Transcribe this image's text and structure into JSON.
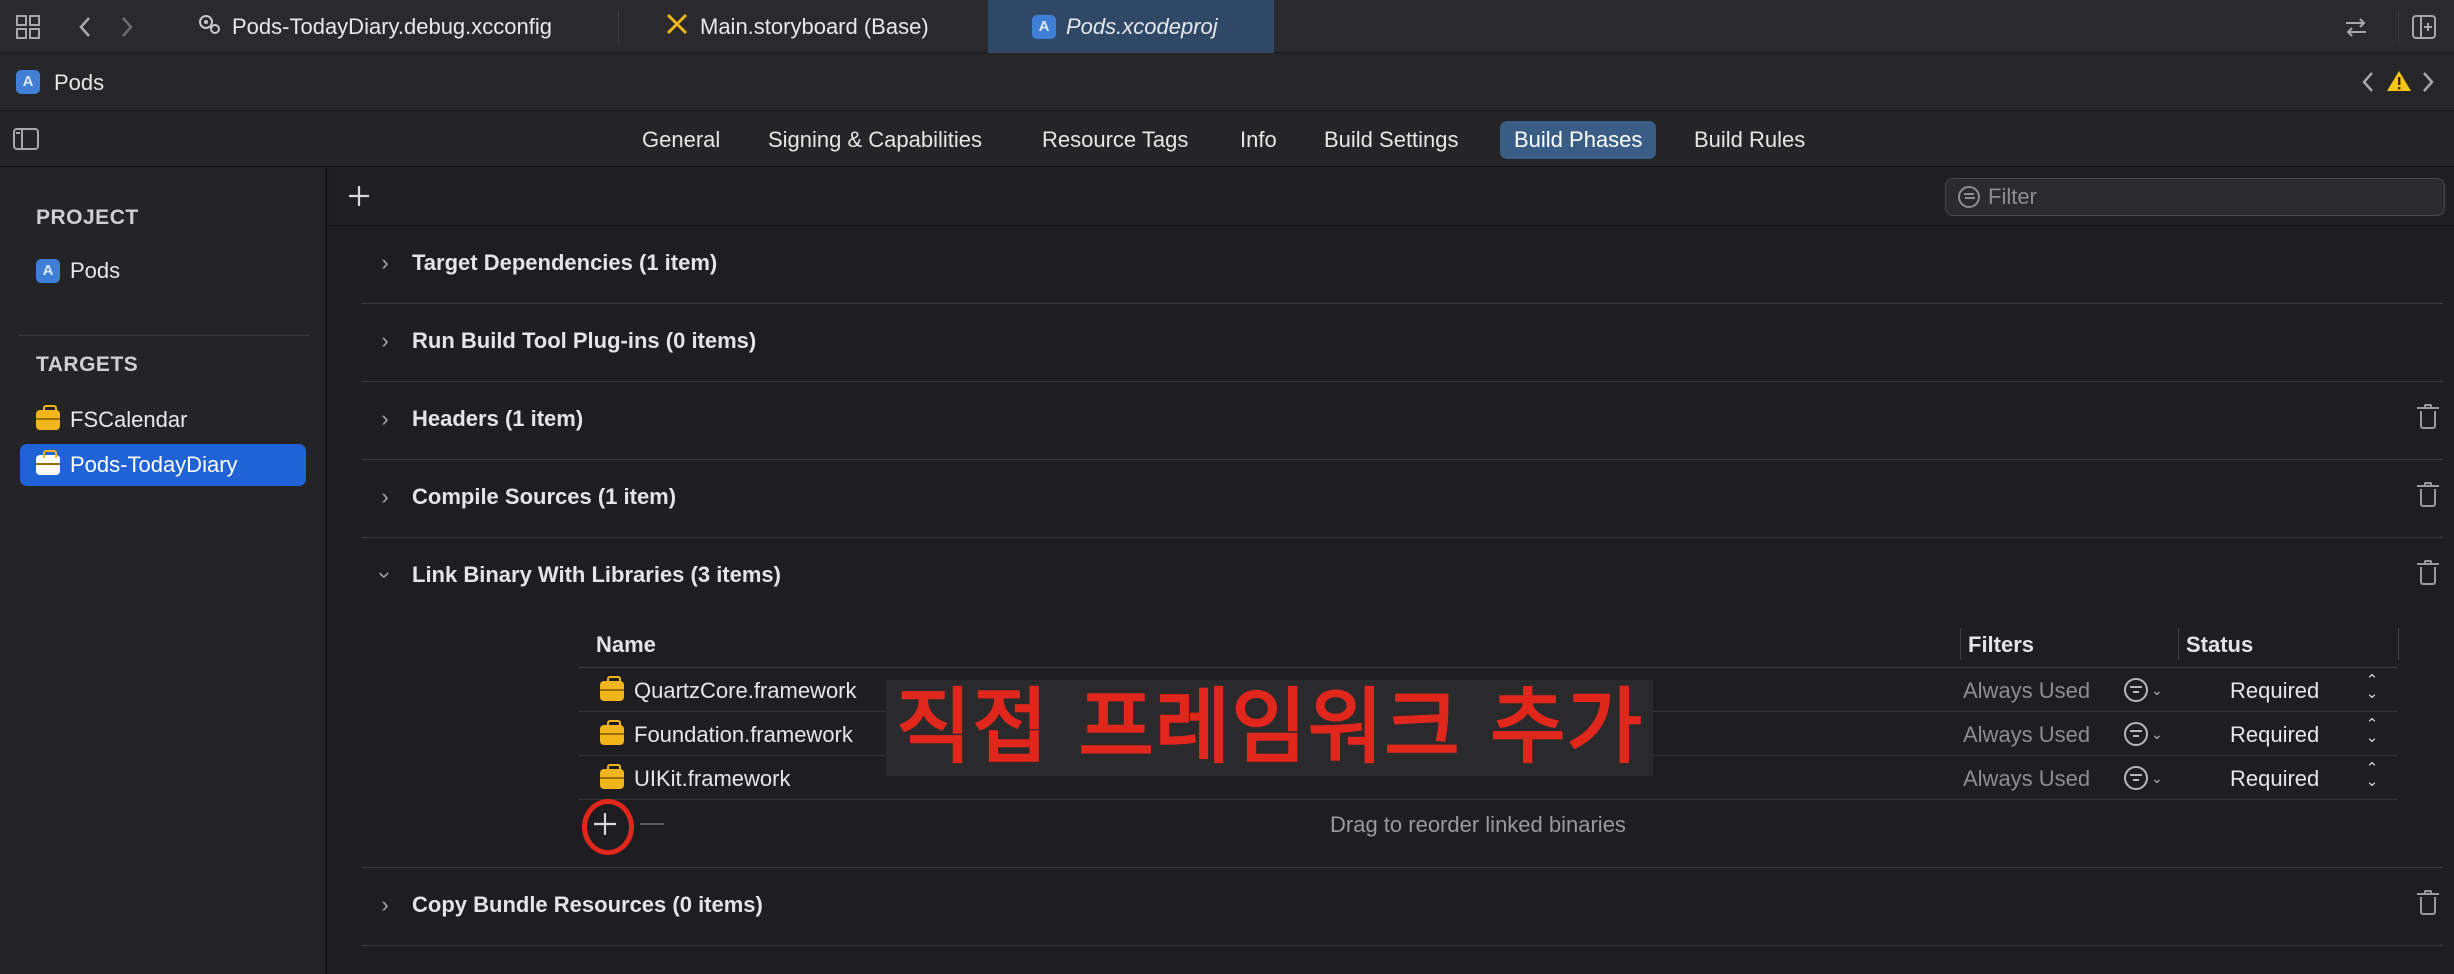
{
  "window": {
    "tabs": [
      {
        "label": "Pods-TodayDiary.debug.xcconfig",
        "icon": "gear-icon",
        "active": false
      },
      {
        "label": "Main.storyboard (Base)",
        "icon": "storyboard-icon",
        "active": false
      },
      {
        "label": "Pods.xcodeproj",
        "icon": "project-icon",
        "active": true
      }
    ]
  },
  "pathbar": {
    "project": "Pods"
  },
  "editor_tabs": [
    "General",
    "Signing & Capabilities",
    "Resource Tags",
    "Info",
    "Build Settings",
    "Build Phases",
    "Build Rules"
  ],
  "editor_tabs_selected": "Build Phases",
  "sidebar": {
    "project_header": "PROJECT",
    "project_item": "Pods",
    "targets_header": "TARGETS",
    "targets": [
      "FSCalendar",
      "Pods-TodayDiary"
    ],
    "selected_target": "Pods-TodayDiary"
  },
  "filter": {
    "placeholder": "Filter"
  },
  "phases": [
    {
      "title": "Target Dependencies (1 item)",
      "expanded": false,
      "deletable": false
    },
    {
      "title": "Run Build Tool Plug-ins (0 items)",
      "expanded": false,
      "deletable": false
    },
    {
      "title": "Headers (1 item)",
      "expanded": false,
      "deletable": true
    },
    {
      "title": "Compile Sources (1 item)",
      "expanded": false,
      "deletable": true
    },
    {
      "title": "Link Binary With Libraries (3 items)",
      "expanded": true,
      "deletable": true
    },
    {
      "title": "Copy Bundle Resources (0 items)",
      "expanded": false,
      "deletable": true
    }
  ],
  "libraries": {
    "columns": {
      "name": "Name",
      "filters": "Filters",
      "status": "Status"
    },
    "rows": [
      {
        "name": "QuartzCore.framework",
        "filters": "Always Used",
        "status": "Required"
      },
      {
        "name": "Foundation.framework",
        "filters": "Always Used",
        "status": "Required"
      },
      {
        "name": "UIKit.framework",
        "filters": "Always Used",
        "status": "Required"
      }
    ],
    "footer_hint": "Drag to reorder linked binaries"
  },
  "annotation": {
    "text": "직접 프레임워크 추가",
    "color": "#e1261c"
  },
  "colors": {
    "accent": "#1f63d6",
    "selected_tab": "#3a5d86",
    "warning": "#f5c518"
  }
}
